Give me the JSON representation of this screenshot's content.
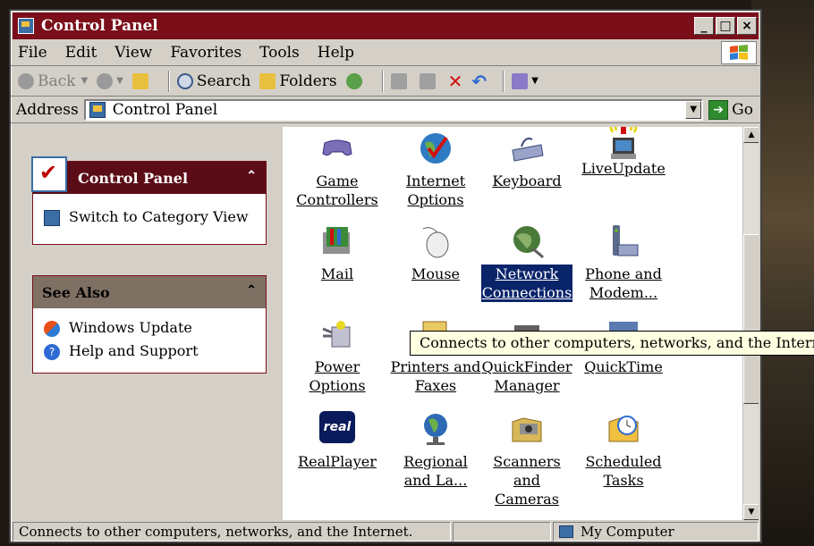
{
  "window": {
    "title": "Control Panel"
  },
  "window_buttons": {
    "minimize": "_",
    "maximize": "□",
    "close": "×"
  },
  "menu": [
    "File",
    "Edit",
    "View",
    "Favorites",
    "Tools",
    "Help"
  ],
  "toolbar": {
    "back": "Back",
    "search": "Search",
    "folders": "Folders"
  },
  "address": {
    "label": "Address",
    "value": "Control Panel",
    "go": "Go"
  },
  "left_pane": {
    "control_panel": {
      "title": "Control Panel",
      "items": [
        "Switch to Category View"
      ]
    },
    "see_also": {
      "title": "See Also",
      "items": [
        "Windows Update",
        "Help and Support"
      ]
    }
  },
  "icons": [
    {
      "line1": "Game",
      "line2": "Controllers",
      "icon": "game-controller-icon",
      "color": "#7b6fb8"
    },
    {
      "line1": "Internet",
      "line2": "Options",
      "icon": "internet-options-icon",
      "color": "#2e7bc4"
    },
    {
      "line1": "Keyboard",
      "line2": "",
      "icon": "keyboard-icon",
      "color": "#9aa3c8"
    },
    {
      "line1": "LiveUpdate",
      "line2": "",
      "icon": "liveupdate-icon",
      "color": "#e8d820"
    },
    {
      "line1": "Mail",
      "line2": "",
      "icon": "mail-icon",
      "color": "#3a8a3a"
    },
    {
      "line1": "Mouse",
      "line2": "",
      "icon": "mouse-icon",
      "color": "#e8e8e8"
    },
    {
      "line1": "Network",
      "line2": "Connections",
      "icon": "network-connections-icon",
      "color": "#4a7a3a",
      "selected": true
    },
    {
      "line1": "Phone and",
      "line2": "Modem...",
      "icon": "phone-modem-icon",
      "color": "#5a6a8a"
    },
    {
      "line1": "Power",
      "line2": "Options",
      "icon": "power-options-icon",
      "color": "#c0c0d0"
    },
    {
      "line1": "Printers and",
      "line2": "Faxes",
      "icon": "printers-faxes-icon",
      "color": "#e8c860"
    },
    {
      "line1": "QuickFinder",
      "line2": "Manager",
      "icon": "quickfinder-icon",
      "color": "#606060"
    },
    {
      "line1": "QuickTime",
      "line2": "",
      "icon": "quicktime-icon",
      "color": "#5a7ab0"
    },
    {
      "line1": "RealPlayer",
      "line2": "",
      "icon": "realplayer-icon",
      "color": "#0a1a5a"
    },
    {
      "line1": "Regional",
      "line2": "and La...",
      "icon": "regional-language-icon",
      "color": "#2e6ab4"
    },
    {
      "line1": "Scanners",
      "line2": "and Cameras",
      "icon": "scanners-cameras-icon",
      "color": "#d8b858"
    },
    {
      "line1": "Scheduled",
      "line2": "Tasks",
      "icon": "scheduled-tasks-icon",
      "color": "#f0c040"
    }
  ],
  "realplayer_logo_text": "real",
  "tooltip": "Connects to other computers, networks, and the Internet.",
  "status": {
    "text": "Connects to other computers, networks, and the Internet.",
    "zone": "My Computer"
  }
}
